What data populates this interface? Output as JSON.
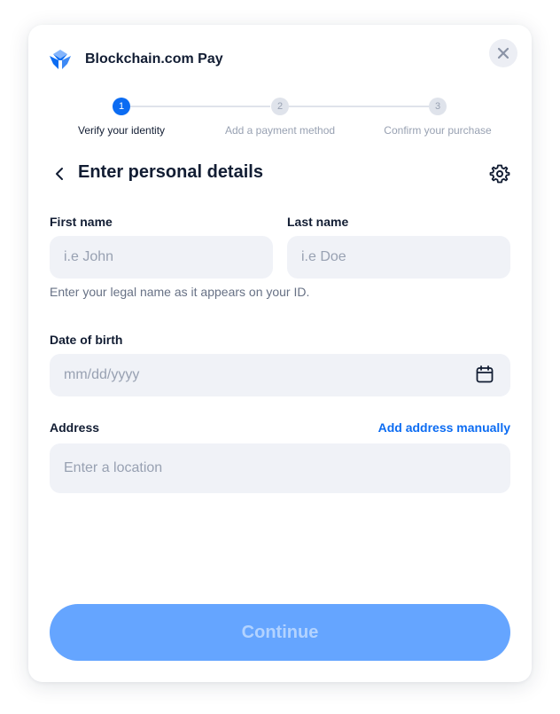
{
  "header": {
    "brand": "Blockchain.com Pay",
    "close_icon": "close-icon",
    "logo_icon": "blockchain-logo-icon"
  },
  "stepper": {
    "steps": [
      {
        "number": "1",
        "label": "Verify your identity",
        "state": "active"
      },
      {
        "number": "2",
        "label": "Add a payment method",
        "state": "inactive"
      },
      {
        "number": "3",
        "label": "Confirm your purchase",
        "state": "inactive"
      }
    ]
  },
  "page": {
    "title": "Enter personal details",
    "back_icon": "chevron-left-icon",
    "settings_icon": "gear-icon"
  },
  "form": {
    "first_name": {
      "label": "First name",
      "placeholder": "i.e John",
      "value": ""
    },
    "last_name": {
      "label": "Last name",
      "placeholder": "i.e Doe",
      "value": ""
    },
    "name_help": "Enter your legal name as it appears on your ID.",
    "dob": {
      "label": "Date of birth",
      "placeholder": "mm/dd/yyyy",
      "value": "",
      "icon": "calendar-icon"
    },
    "address": {
      "label": "Address",
      "placeholder": "Enter a location",
      "value": "",
      "manual_link": "Add address manually"
    }
  },
  "actions": {
    "continue_label": "Continue"
  },
  "colors": {
    "primary": "#0c6cf2",
    "button_disabled_bg": "#65a5ff",
    "input_bg": "#f0f2f7",
    "text_dark": "#121d33",
    "text_muted": "#98a1b2"
  }
}
